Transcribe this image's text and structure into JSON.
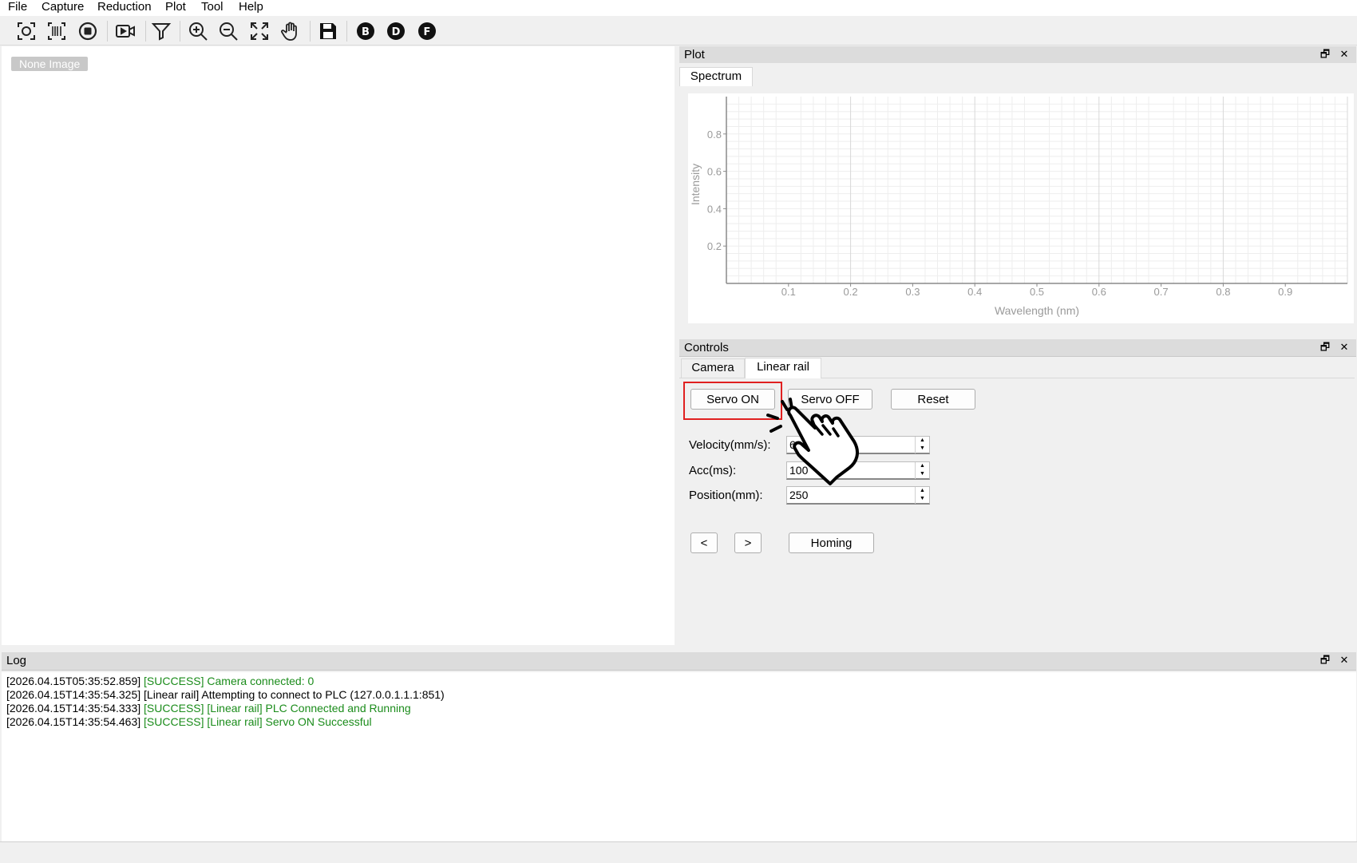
{
  "menu": [
    "File",
    "Capture",
    "Reduction",
    "Plot",
    "Tool",
    "Help"
  ],
  "toolbar": {
    "icons": [
      "capture-icon",
      "barcode-scan-icon",
      "stop-icon",
      "video-camera-icon",
      "filter-icon",
      "zoom-in-icon",
      "zoom-out-icon",
      "fit-screen-icon",
      "pan-hand-icon",
      "save-icon",
      "b-circle-icon",
      "d-circle-icon",
      "f-circle-icon"
    ],
    "letters": {
      "b": "B",
      "d": "D",
      "f": "F"
    }
  },
  "image_view": {
    "placeholder": "None Image"
  },
  "plot_dock": {
    "title": "Plot",
    "tab": "Spectrum",
    "chart_data": {
      "type": "line",
      "series": [],
      "xlabel": "Wavelength (nm)",
      "ylabel": "Intensity",
      "xlim": [
        0,
        1
      ],
      "ylim": [
        0,
        1
      ],
      "xticks": [
        "0.1",
        "0.2",
        "0.3",
        "0.4",
        "0.5",
        "0.6",
        "0.7",
        "0.8",
        "0.9"
      ],
      "yticks": [
        "0.2",
        "0.4",
        "0.6",
        "0.8"
      ],
      "grid": true
    }
  },
  "controls_dock": {
    "title": "Controls",
    "tabs": [
      "Camera",
      "Linear rail"
    ],
    "active_tab": "Linear rail",
    "buttons": {
      "servo_on": "Servo ON",
      "servo_off": "Servo OFF",
      "reset": "Reset",
      "prev": "<",
      "next": ">",
      "homing": "Homing"
    },
    "fields": [
      {
        "label": "Velocity(mm/s):",
        "value": "6"
      },
      {
        "label": "Acc(ms):",
        "value": "100"
      },
      {
        "label": "Position(mm):",
        "value": "250"
      }
    ]
  },
  "log_dock": {
    "title": "Log",
    "lines": [
      {
        "ts": "[2026.04.15T05:35:52.859]",
        "msg": "[SUCCESS] Camera connected: 0",
        "level": "success"
      },
      {
        "ts": "[2026.04.15T14:35:54.325]",
        "msg": "[Linear rail] Attempting to connect to PLC (127.0.0.1.1.1:851)",
        "level": "info"
      },
      {
        "ts": "[2026.04.15T14:35:54.333]",
        "msg": "[SUCCESS] [Linear rail] PLC Connected and Running",
        "level": "success"
      },
      {
        "ts": "[2026.04.15T14:35:54.463]",
        "msg": "[SUCCESS] [Linear rail] Servo ON Successful",
        "level": "success"
      }
    ]
  },
  "dock_buttons": {
    "float": "🗗",
    "close": "✕"
  },
  "colors": {
    "success": "#1b8c1b",
    "highlight": "#e02020",
    "grid": "#d8d8d8",
    "axis": "#8a8a8a"
  }
}
